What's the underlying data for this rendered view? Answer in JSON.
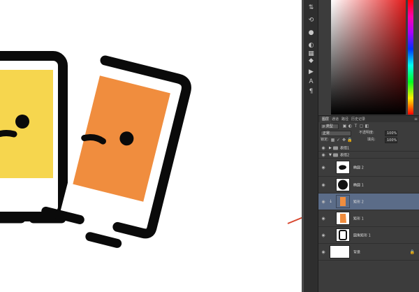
{
  "tabs": [
    "图层",
    "通道",
    "路径",
    "历史记录"
  ],
  "blend_mode": "正常",
  "opacity": {
    "label": "不透明度:",
    "value": "100%"
  },
  "fill": {
    "label": "填充:",
    "value": "100%"
  },
  "lock_label": "锁定:",
  "kind_filter": "p 类型",
  "layers": [
    {
      "name": "表情1",
      "type": "group",
      "expanded": false
    },
    {
      "name": "表情2",
      "type": "group",
      "expanded": true
    },
    {
      "name": "椭圆 2",
      "type": "shape"
    },
    {
      "name": "椭圆 1",
      "type": "shape"
    },
    {
      "name": "矩形 2",
      "type": "shape",
      "selected": true,
      "clipped": true
    },
    {
      "name": "矩形 1",
      "type": "shape"
    },
    {
      "name": "圆角矩形 1",
      "type": "shape"
    },
    {
      "name": "背景",
      "type": "background",
      "locked": true
    }
  ],
  "colors": {
    "yellow_card": "#f6d64e",
    "orange_card": "#f08d3e",
    "outline": "#0a0a0a",
    "arrow": "#d8472f",
    "selected_layer": "#5b6c88",
    "panel_bg": "#3c3c3c"
  },
  "icons": [
    "move-tool-icon",
    "history-icon",
    "info-icon",
    "adjust-icon",
    "type-icon",
    "paragraph-icon",
    "play-icon",
    "character-icon",
    "paragraph-style-icon"
  ]
}
